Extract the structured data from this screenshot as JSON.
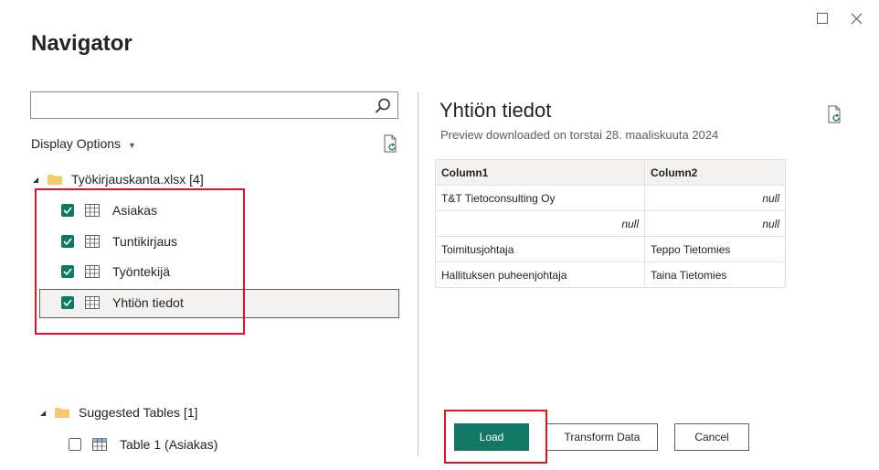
{
  "dialog": {
    "title": "Navigator",
    "window_controls": {
      "maximize_icon": "square-icon",
      "close_icon": "x-icon"
    }
  },
  "left": {
    "search": {
      "value": "",
      "placeholder": ""
    },
    "display_options_label": "Display Options",
    "tree": {
      "file": {
        "label": "Työkirjauskanta.xlsx [4]",
        "expanded": true
      },
      "items": [
        {
          "label": "Asiakas",
          "checked": true
        },
        {
          "label": "Tuntikirjaus",
          "checked": true
        },
        {
          "label": "Työntekijä",
          "checked": true
        },
        {
          "label": "Yhtiön tiedot",
          "checked": true,
          "selected": true
        }
      ],
      "suggested": {
        "label": "Suggested Tables [1]",
        "expanded": true
      },
      "suggested_items": [
        {
          "label": "Table 1 (Asiakas)",
          "checked": false
        }
      ]
    }
  },
  "preview": {
    "title": "Yhtiön tiedot",
    "subtitle": "Preview downloaded on torstai 28. maaliskuuta 2024",
    "columns": [
      "Column1",
      "Column2"
    ],
    "rows": [
      [
        "T&T Tietoconsulting Oy",
        "null"
      ],
      [
        "null",
        "null"
      ],
      [
        "Toimitusjohtaja",
        "Teppo Tietomies"
      ],
      [
        "Hallituksen puheenjohtaja",
        "Taina Tietomies"
      ]
    ]
  },
  "buttons": {
    "load": "Load",
    "transform": "Transform Data",
    "cancel": "Cancel"
  },
  "colors": {
    "accent": "#117865",
    "highlight_box": "#e81123"
  }
}
